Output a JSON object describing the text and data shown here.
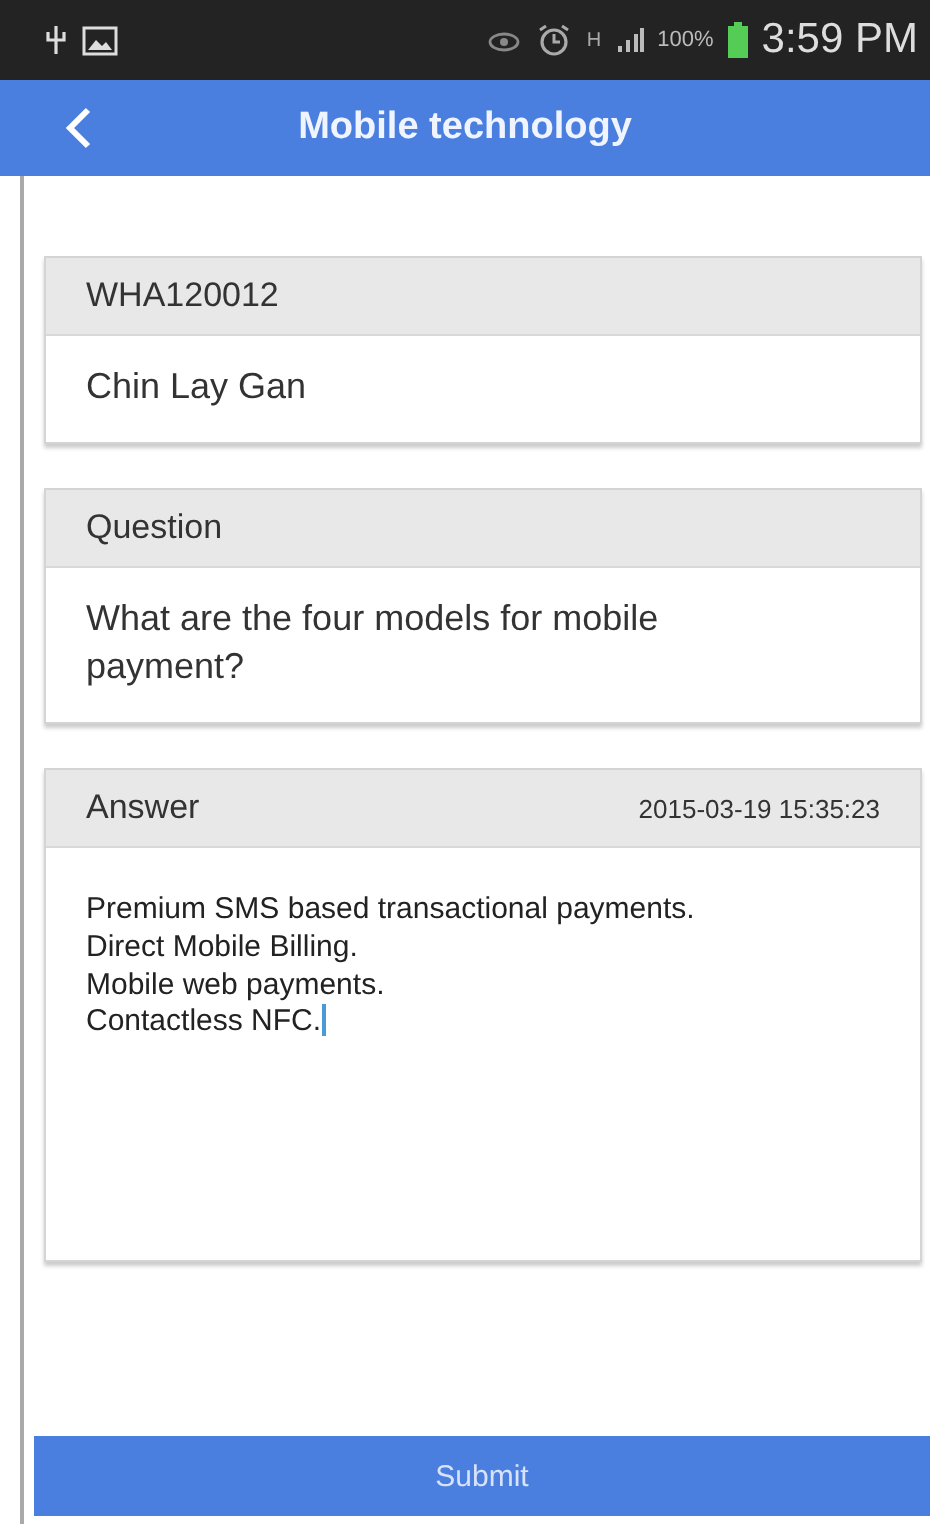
{
  "status_bar": {
    "battery_text": "100%",
    "network_text": "H",
    "time": "3:59 PM"
  },
  "app_bar": {
    "title": "Mobile technology"
  },
  "cards": [
    {
      "kind": "info",
      "header": "WHA120012",
      "body": "Chin Lay Gan"
    },
    {
      "kind": "info",
      "header": "Question",
      "body": "What are the four models for mobile payment?"
    },
    {
      "kind": "answer",
      "header": "Answer",
      "timestamp": "2015-03-19 15:35:23",
      "value": "Premium SMS based transactional payments.\nDirect Mobile Billing.\nMobile web payments.\nContactless NFC.",
      "focused": true
    }
  ],
  "submit": {
    "label": "Submit"
  }
}
